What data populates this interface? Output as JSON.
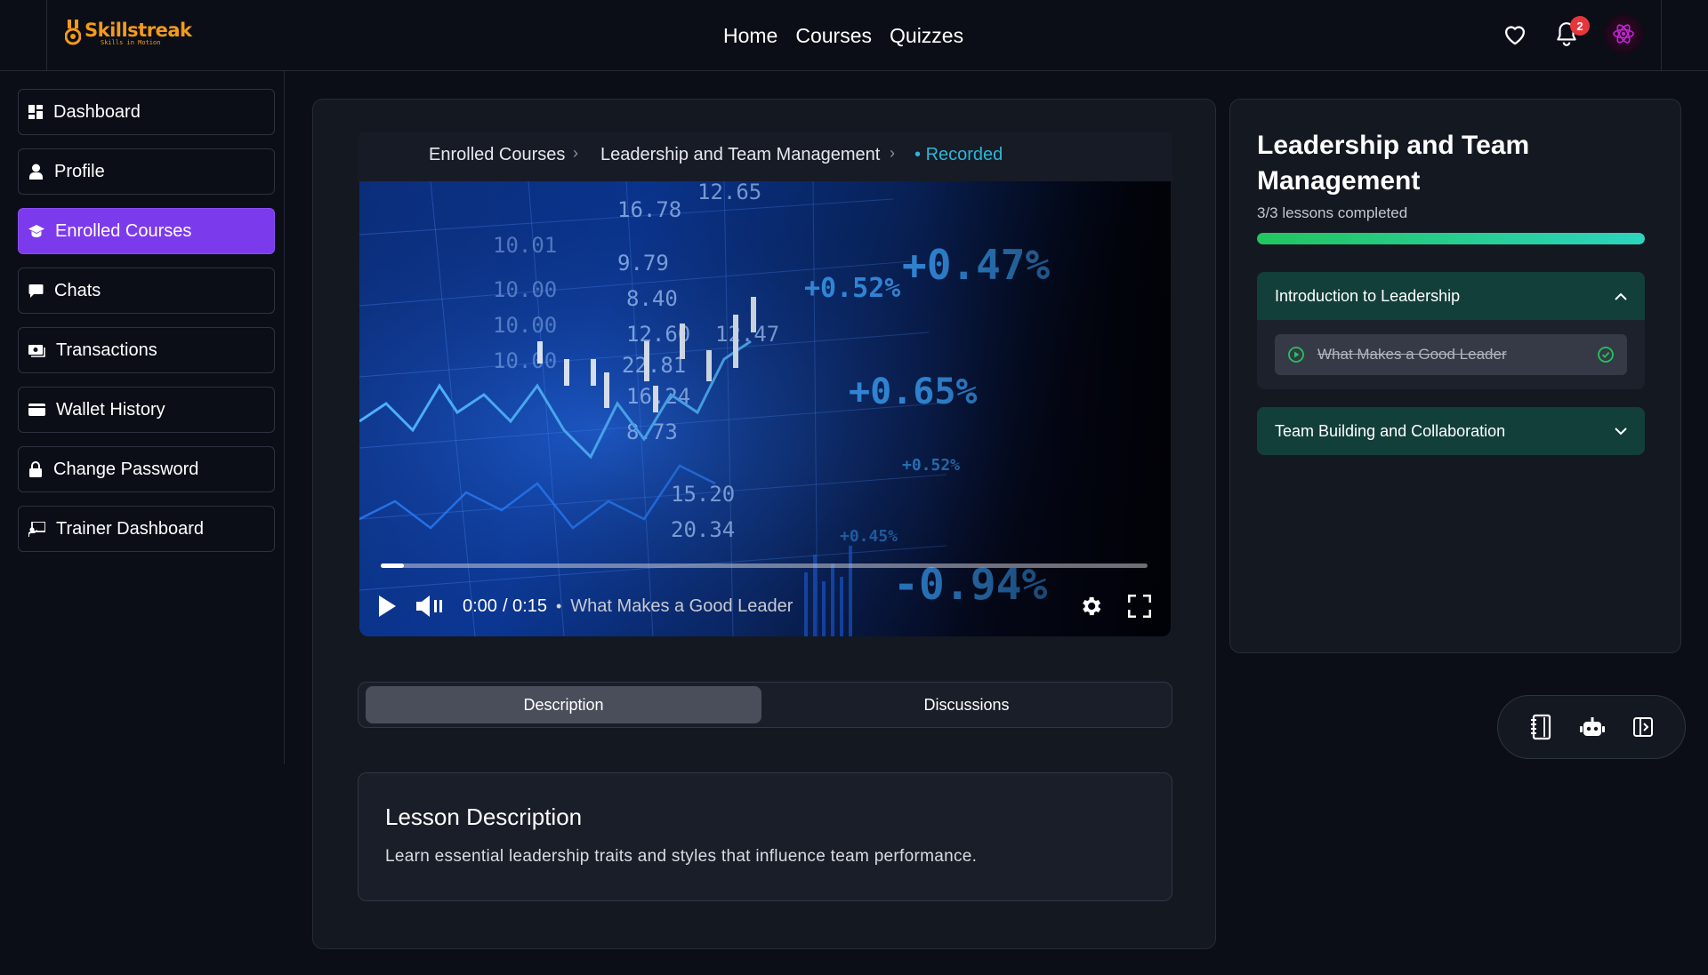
{
  "header": {
    "logo_title": "Skillstreak",
    "logo_tagline": "Skills in Motion",
    "nav": [
      "Home",
      "Courses",
      "Quizzes"
    ],
    "notification_count": "2",
    "brand_color": "#f39a1c"
  },
  "sidebar": {
    "items": [
      {
        "label": "Dashboard",
        "icon": "dashboard-icon"
      },
      {
        "label": "Profile",
        "icon": "user-icon"
      },
      {
        "label": "Enrolled Courses",
        "icon": "graduation-cap-icon",
        "active": true
      },
      {
        "label": "Chats",
        "icon": "chat-icon"
      },
      {
        "label": "Transactions",
        "icon": "money-icon"
      },
      {
        "label": "Wallet History",
        "icon": "wallet-icon"
      },
      {
        "label": "Change Password",
        "icon": "lock-icon"
      },
      {
        "label": "Trainer Dashboard",
        "icon": "trainer-icon"
      }
    ],
    "active_color": "#7c3aed"
  },
  "breadcrumb": {
    "items": [
      "Enrolled Courses",
      "Leadership and Team Management"
    ],
    "current": "Recorded"
  },
  "video": {
    "current_time": "0:00",
    "duration": "/ 0:15",
    "title": "What Makes a Good Leader",
    "progress": 0.03
  },
  "tabs": [
    {
      "label": "Description",
      "active": true
    },
    {
      "label": "Discussions",
      "active": false
    }
  ],
  "lesson": {
    "heading": "Lesson Description",
    "text": "Learn essential leadership traits and styles that influence team performance."
  },
  "course": {
    "title": "Leadership and Team Management",
    "lessons_completed": "3/3 lessons completed",
    "progress": 1.0,
    "sections": [
      {
        "title": "Introduction to Leadership",
        "expanded": true,
        "lessons": [
          {
            "title": "What Makes a Good Leader",
            "completed": true
          }
        ]
      },
      {
        "title": "Team Building and Collaboration",
        "expanded": false,
        "lessons": []
      }
    ]
  },
  "floating_toolbar": [
    "notebook-icon",
    "robot-icon",
    "panel-toggle-icon"
  ]
}
